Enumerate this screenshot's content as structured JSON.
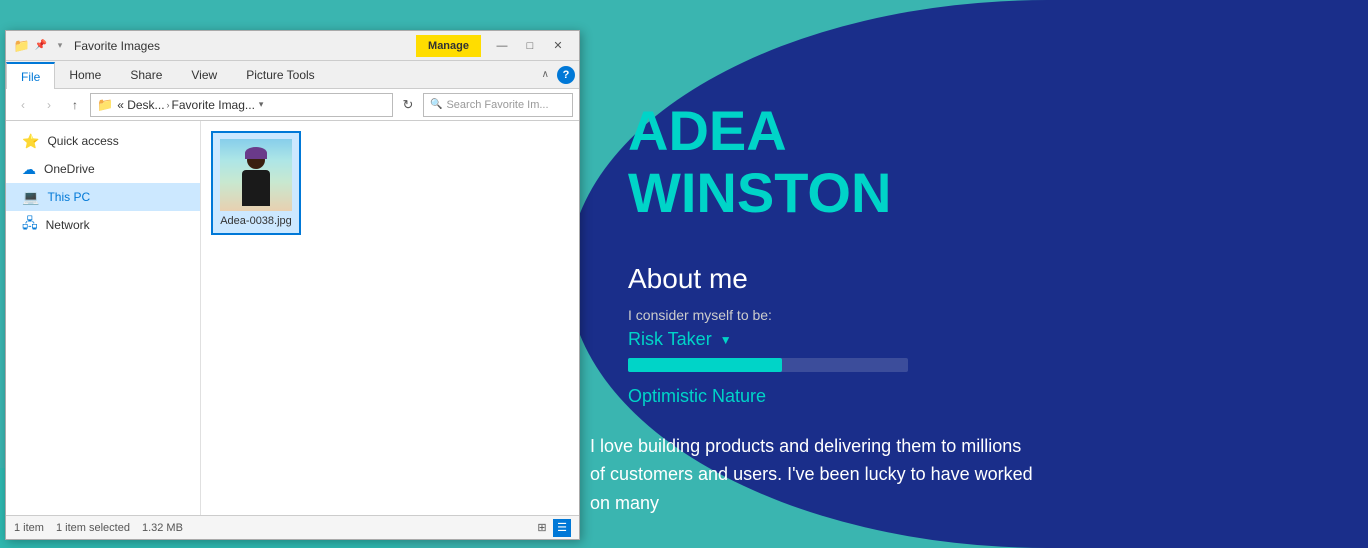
{
  "window": {
    "title": "Favorite Images",
    "manage_label": "Manage",
    "minimize": "—",
    "maximize": "□",
    "close": "✕"
  },
  "ribbon": {
    "tabs": [
      "File",
      "Home",
      "Share",
      "View",
      "Picture Tools"
    ],
    "active_tab": "File"
  },
  "address_bar": {
    "back_title": "Back",
    "forward_title": "Forward",
    "up_title": "Up",
    "path_short": "« Desk...",
    "path_separator": "›",
    "path_folder": "Favorite Imag...",
    "search_placeholder": "Search Favorite Im..."
  },
  "sidebar": {
    "items": [
      {
        "id": "quick-access",
        "label": "Quick access",
        "icon": "⭐"
      },
      {
        "id": "onedrive",
        "label": "OneDrive",
        "icon": "☁"
      },
      {
        "id": "this-pc",
        "label": "This PC",
        "icon": "💻",
        "active": true
      },
      {
        "id": "network",
        "label": "Network",
        "icon": "🖧"
      }
    ]
  },
  "files": [
    {
      "id": "adea-0038",
      "name": "Adea-0038.jpg",
      "selected": true
    }
  ],
  "status_bar": {
    "item_count": "1 item",
    "selected_info": "1 item selected",
    "file_size": "1.32 MB"
  },
  "profile": {
    "first_name": "ADEA",
    "last_name": "WINSTON",
    "about_title": "About me",
    "consider_label": "I consider myself to be:",
    "trait1": "Risk Taker",
    "trait1_progress": 55,
    "trait2": "Optimistic Nature"
  },
  "quote": {
    "text": "I love building products and delivering them to millions of customers and users. I've been lucky to have worked on many"
  }
}
